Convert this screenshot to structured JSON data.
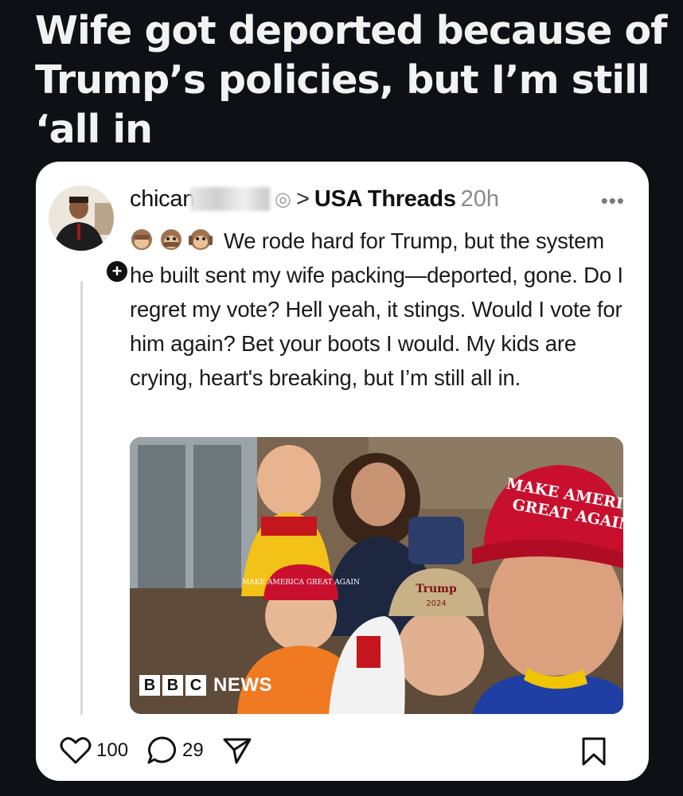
{
  "headline": "Wife got deported because of Trump’s policies, but I’m still ‘all in",
  "post": {
    "username": "chican",
    "community_separator": ">",
    "community": "USA Threads",
    "time": "20h",
    "more_label": "•••",
    "avatar_action": "+",
    "text": "We rode hard for Trump, but the system he built sent my wife packing—deported, gone. Do I regret my vote? Hell yeah, it stings. Would I vote for him again? Bet your boots I would. My kids are crying, heart's breaking, but I’m still all in.",
    "image": {
      "hat_text_line1": "MAKE AMERICA",
      "hat_text_line2": "GREAT AGAIN",
      "small_hat_text": "MAKE AMERICA GREAT AGAIN",
      "cap_text": "Trump",
      "cap_year": "2024",
      "watermark_blocks": [
        "B",
        "B",
        "C"
      ],
      "watermark_news": "NEWS"
    }
  },
  "actions": {
    "likes": "100",
    "replies": "29"
  },
  "colors": {
    "background": "#0d1116",
    "card": "#ffffff",
    "maga_red": "#c8102e"
  }
}
